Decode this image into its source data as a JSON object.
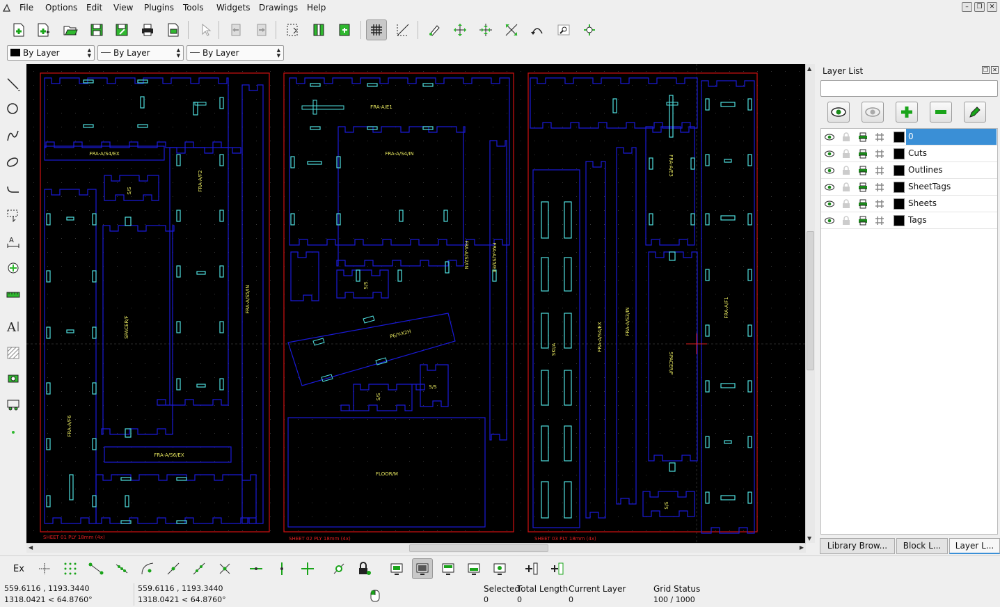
{
  "menu": [
    "File",
    "Options",
    "Edit",
    "View",
    "Plugins",
    "Tools",
    "Widgets",
    "Drawings",
    "Help"
  ],
  "pen": {
    "color_label": "By Layer",
    "width_label": "By Layer",
    "type_label": "By Layer"
  },
  "canvas": {
    "sheet_labels": [
      "SHEET 01 PLY 18mm (4x)",
      "SHEET 02 PLY 18mm (4x)",
      "SHEET 03 PLY 18mm (4x)"
    ],
    "part_labels": [
      "FRA-A/S4/EX",
      "S/S",
      "FRA-A/F2",
      "FRA-A/S5/IN",
      "SPACER/F",
      "FRA-A/F6",
      "FRA-A/S6/EX",
      "FRA-A/E1",
      "FRA-A/S4/IN",
      "FRA-A/S2/IN",
      "FRA-A/S5/EX",
      "S/S",
      "P6/Y-X2H",
      "S/S",
      "S/S",
      "FLOOR/M",
      "FRA-A/E3",
      "SKI/A",
      "FRA-A/S4/EX",
      "FRA-A/S3/IN",
      "SPACER/F",
      "FRA-A/F1",
      "S/S"
    ],
    "colors": {
      "background": "#000000",
      "sheet_border": "#d01010",
      "outline": "#1a1ad8",
      "cut": "#4fe0e0",
      "tag": "#e8e860",
      "sheet_tag": "#e02020"
    }
  },
  "layer_panel": {
    "title": "Layer List",
    "filter_value": "",
    "layers": [
      {
        "name": "0",
        "selected": true
      },
      {
        "name": "Cuts",
        "selected": false
      },
      {
        "name": "Outlines",
        "selected": false
      },
      {
        "name": "SheetTags",
        "selected": false
      },
      {
        "name": "Sheets",
        "selected": false
      },
      {
        "name": "Tags",
        "selected": false
      }
    ],
    "tabs": [
      "Library Brow...",
      "Block L...",
      "Layer L..."
    ]
  },
  "snap": {
    "ex_label": "Ex"
  },
  "status": {
    "abs_coord": "559.6116 , 1193.3440",
    "abs_polar": "1318.0421 < 64.8760°",
    "rel_coord": "559.6116 , 1193.3440",
    "rel_polar": "1318.0421 < 64.8760°",
    "selected_label": "Selected",
    "selected_value": "0",
    "total_length_label": "Total Length",
    "total_length_value": "0",
    "current_layer_label": "Current Layer",
    "current_layer_value": "0",
    "grid_status_label": "Grid Status",
    "grid_status_value": "100 / 1000"
  }
}
